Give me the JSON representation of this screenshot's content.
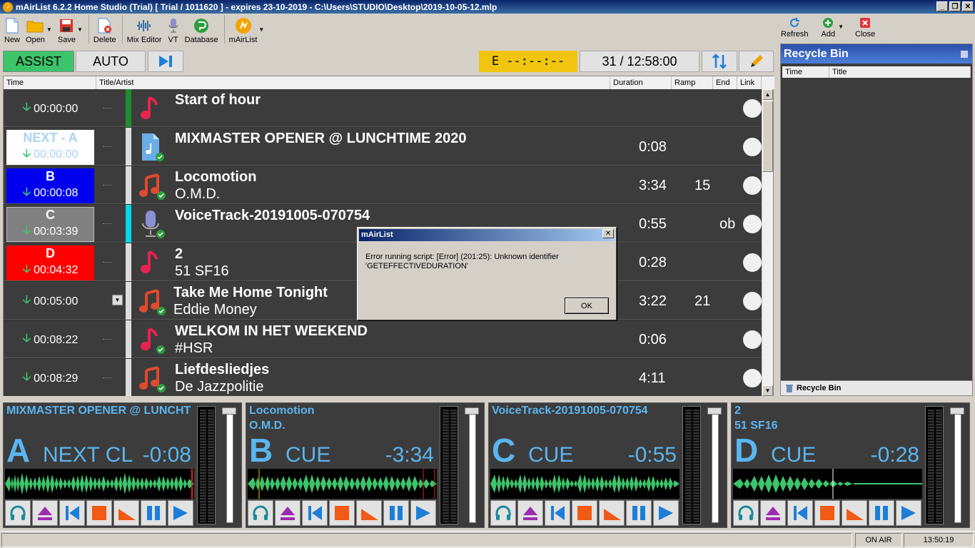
{
  "window": {
    "title": "mAirList 6.2.2 Home Studio (Trial) [ Trial / 1011620 ] - expires 23-10-2019 - C:\\Users\\STUDIO\\Desktop\\2019-10-05-12.mlp"
  },
  "toolbar": {
    "new": "New",
    "open": "Open",
    "save": "Save",
    "delete": "Delete",
    "mix_editor": "Mix Editor",
    "vt": "VT",
    "database": "Database",
    "mairlist": "mAirList"
  },
  "mode": {
    "assist": "ASSIST",
    "auto": "AUTO",
    "e_display": "E   --:--:--",
    "time_display": "31 / 12:58:00"
  },
  "columns": {
    "time": "Time",
    "title_artist": "Title/Artist",
    "duration": "Duration",
    "ramp": "Ramp",
    "end": "End",
    "link": "Link"
  },
  "rows": [
    {
      "label": "",
      "time": "00:00:00",
      "title": "Start of hour",
      "artist": "",
      "duration": "",
      "ramp": "",
      "end": ""
    },
    {
      "label": "NEXT - A",
      "time": "00:00:00",
      "title": "MIXMASTER OPENER @ LUNCHTIME 2020",
      "artist": "",
      "duration": "0:08",
      "ramp": "",
      "end": ""
    },
    {
      "label": "B",
      "time": "00:00:08",
      "title": "Locomotion",
      "artist": "O.M.D.",
      "duration": "3:34",
      "ramp": "15",
      "end": ""
    },
    {
      "label": "C",
      "time": "00:03:39",
      "title": "VoiceTrack-20191005-070754",
      "artist": "",
      "duration": "0:55",
      "ramp": "",
      "end": "ob"
    },
    {
      "label": "D",
      "time": "00:04:32",
      "title": "2",
      "artist": "51 SF16",
      "duration": "0:28",
      "ramp": "",
      "end": ""
    },
    {
      "label": "",
      "time": "00:05:00",
      "title": "Take Me Home Tonight",
      "artist": "Eddie Money",
      "duration": "3:22",
      "ramp": "21",
      "end": ""
    },
    {
      "label": "",
      "time": "00:08:22",
      "title": "WELKOM IN HET WEEKEND",
      "artist": "#HSR",
      "duration": "0:06",
      "ramp": "",
      "end": ""
    },
    {
      "label": "",
      "time": "00:08:29",
      "title": "Liefdesliedjes",
      "artist": "De Jazzpolitie",
      "duration": "4:11",
      "ramp": "",
      "end": ""
    }
  ],
  "recycle": {
    "refresh": "Refresh",
    "add": "Add",
    "close": "Close",
    "title": "Recycle Bin",
    "col_time": "Time",
    "col_title": "Title",
    "footer": "Recycle Bin"
  },
  "players": [
    {
      "title": "MIXMASTER OPENER @ LUNCHT",
      "artist": "",
      "letter": "A",
      "state": "NEXT CL",
      "time": "-0:08"
    },
    {
      "title": "Locomotion",
      "artist": "O.M.D.",
      "letter": "B",
      "state": "CUE",
      "time": "-3:34"
    },
    {
      "title": "VoiceTrack-20191005-070754",
      "artist": "",
      "letter": "C",
      "state": "CUE",
      "time": "-0:55"
    },
    {
      "title": "2",
      "artist": "51 SF16",
      "letter": "D",
      "state": "CUE",
      "time": "-0:28"
    }
  ],
  "dialog": {
    "title": "mAirList",
    "message": "Error running script: [Error] (201:25): Unknown identifier 'GETEFFECTIVEDURATION'",
    "ok": "OK"
  },
  "status": {
    "on_air": "ON AIR",
    "clock": "13:50:19"
  },
  "colors": {
    "assist": "#3cc46a",
    "player_text": "#5bb5f0",
    "e_box": "#f1c40f",
    "label_b": "#0000ee",
    "label_c": "#808080",
    "label_d": "#ff0000"
  }
}
